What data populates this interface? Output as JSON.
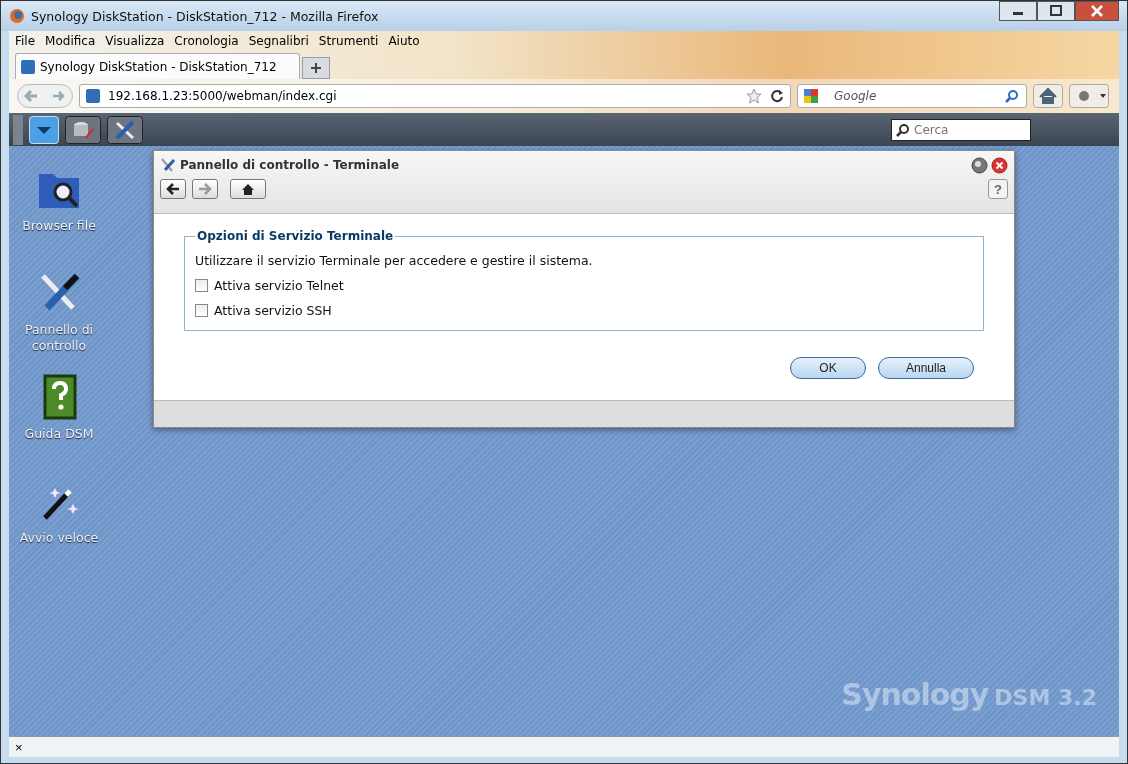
{
  "window": {
    "title": "Synology DiskStation - DiskStation_712 - Mozilla Firefox"
  },
  "menu": [
    "File",
    "Modifica",
    "Visualizza",
    "Cronologia",
    "Segnalibri",
    "Strumenti",
    "Aiuto"
  ],
  "tabs": [
    {
      "label": "Synology DiskStation - DiskStation_712",
      "selected": true
    }
  ],
  "address_bar": {
    "url": "192.168.1.23:5000/webman/index.cgi"
  },
  "web_search": {
    "placeholder": "Google"
  },
  "dsm_taskbar": {
    "search": {
      "placeholder": "Cerca"
    }
  },
  "desktop_icons": [
    {
      "label": "Browser file",
      "kind": "folder"
    },
    {
      "label": "Pannello di controllo",
      "kind": "tools"
    },
    {
      "label": "Guida DSM",
      "kind": "help"
    },
    {
      "label": "Avvio veloce",
      "kind": "wand"
    }
  ],
  "dialog": {
    "title": "Pannello di controllo - Terminale",
    "help": "?",
    "section_title": "Opzioni di Servizio Terminale",
    "description": "Utilizzare il servizio Terminale per accedere e gestire il sistema.",
    "options": [
      {
        "label": "Attiva servizio Telnet",
        "checked": false
      },
      {
        "label": "Attiva servizio SSH",
        "checked": false
      }
    ],
    "buttons": [
      "OK",
      "Annulla"
    ]
  },
  "branding": {
    "name": "Synology",
    "product": "DSM 3.2"
  },
  "status_bar": {
    "close": "×"
  }
}
